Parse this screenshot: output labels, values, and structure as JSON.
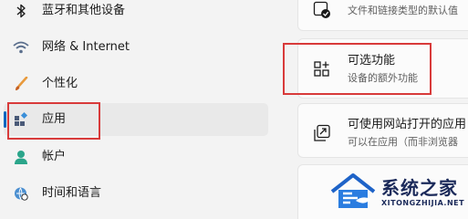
{
  "sidebar": {
    "items": [
      {
        "label": "蓝牙和其他设备",
        "icon": "bluetooth-icon"
      },
      {
        "label": "网络 & Internet",
        "icon": "wifi-icon"
      },
      {
        "label": "个性化",
        "icon": "brush-icon"
      },
      {
        "label": "应用",
        "icon": "apps-icon",
        "active": true
      },
      {
        "label": "帐户",
        "icon": "person-icon"
      },
      {
        "label": "时间和语言",
        "icon": "globe-clock-icon"
      }
    ]
  },
  "main": {
    "cards": [
      {
        "title": "",
        "desc": "文件和链接类型的默认值",
        "icon": "check-default-icon"
      },
      {
        "title": "可选功能",
        "desc": "设备的额外功能",
        "icon": "optional-features-icon"
      },
      {
        "title": "可使用网站打开的应用",
        "desc": "可以在应用（而非浏览器",
        "icon": "open-external-icon"
      }
    ]
  },
  "watermark": {
    "name": "系统之家",
    "url": "XITONGZHIJIA.NET"
  },
  "colors": {
    "accent": "#0067c0",
    "highlight": "#d83a3a",
    "background": "#f3f3f3"
  }
}
